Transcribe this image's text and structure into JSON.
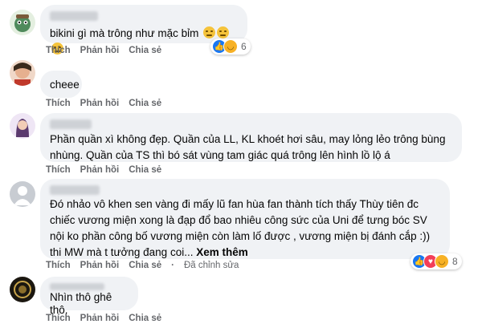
{
  "actions": {
    "like": "Thích",
    "reply": "Phản hồi",
    "share": "Chia sẻ"
  },
  "comments": [
    {
      "text": "bikini gì mà trông như mặc bỉm",
      "emojis": [
        "disappointed-face",
        "disappointed-face",
        "disappointed-face"
      ],
      "reactions": {
        "icons": [
          "like-icon",
          "haha-icon"
        ],
        "count": "6"
      }
    },
    {
      "text": "cheee"
    },
    {
      "text": "Phần quần xì không đẹp. Quần của LL, KL khoét hơi sâu, may lỏng lẻo trông bùng nhùng. Quần của TS thì bó sát vùng tam giác quá trông lên hình lồ lộ á"
    },
    {
      "text": "Đó nhảo vô khen sen vàng đi mấy lũ fan hùa fan thành tích thấy Thùy tiên đc chiếc vương miện xong là đạp đổ bao nhiêu công sức của Uni để tưng bóc SV nội ko phần công bố vương miện còn làm lố được , vương miện bị đánh cắp :)) thi MW mà t tưởng đang coi...",
      "see_more": "Xem thêm",
      "edited": "Đã chỉnh sửa",
      "reactions": {
        "icons": [
          "like-icon",
          "love-icon",
          "haha-icon"
        ],
        "count": "8"
      }
    },
    {
      "text": "Nhìn thô ghê thô."
    }
  ],
  "colors": {
    "bubble": "#f0f2f5",
    "meta": "#65676b",
    "like": "#1877f2",
    "love": "#f33e58",
    "haha": "#f7b125"
  }
}
